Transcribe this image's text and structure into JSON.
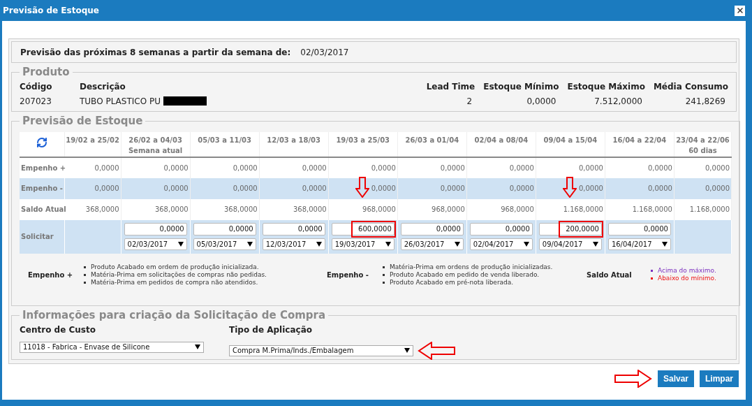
{
  "window": {
    "title": "Previsão de Estoque"
  },
  "forecast_period": {
    "label": "Previsão das próximas 8 semanas a partir da semana de:",
    "date": "02/03/2017"
  },
  "product": {
    "legend": "Produto",
    "identity": [
      {
        "label": "Código",
        "value": "207023",
        "redacted": false
      },
      {
        "label": "Descrição",
        "value": "TUBO PLASTICO PU",
        "redacted": true
      }
    ],
    "metrics": [
      {
        "label": "Lead Time",
        "value": "2"
      },
      {
        "label": "Estoque Mínimo",
        "value": "0,0000"
      },
      {
        "label": "Estoque Máximo",
        "value": "7.512,0000"
      },
      {
        "label": "Média Consumo",
        "value": "241,8269"
      }
    ]
  },
  "forecast": {
    "legend": "Previsão de Estoque",
    "columns": [
      {
        "range": "19/02 a 25/02"
      },
      {
        "range": "26/02 a 04/03",
        "note": "Semana atual"
      },
      {
        "range": "05/03 a 11/03"
      },
      {
        "range": "12/03 a 18/03"
      },
      {
        "range": "19/03 a 25/03"
      },
      {
        "range": "26/03 a 01/04"
      },
      {
        "range": "02/04 a 08/04"
      },
      {
        "range": "09/04 a 15/04"
      },
      {
        "range": "16/04 a 22/04"
      },
      {
        "range": "23/04 a 22/06",
        "note": "60 dias"
      }
    ],
    "rows": [
      {
        "label": "Empenho +",
        "shaded": false,
        "values": [
          "0,0000",
          "0,0000",
          "0,0000",
          "0,0000",
          "0,0000",
          "0,0000",
          "0,0000",
          "0,0000",
          "0,0000",
          "0,0000"
        ]
      },
      {
        "label": "Empenho -",
        "shaded": true,
        "values": [
          "0,0000",
          "0,0000",
          "0,0000",
          "0,0000",
          "0,0000",
          "0,0000",
          "0,0000",
          "0,0000",
          "0,0000",
          "0,0000"
        ]
      },
      {
        "label": "Saldo Atual",
        "shaded": false,
        "values": [
          "368,0000",
          "368,0000",
          "368,0000",
          "368,0000",
          "968,0000",
          "968,0000",
          "968,0000",
          "1.168,0000",
          "1.168,0000",
          "1.168,0000"
        ]
      }
    ],
    "request_row": {
      "label": "Solicitar",
      "cells": [
        {
          "kind": "empty"
        },
        {
          "kind": "entry",
          "quantity": "0,0000",
          "date": "02/03/2017",
          "highlighted": false
        },
        {
          "kind": "entry",
          "quantity": "0,0000",
          "date": "05/03/2017",
          "highlighted": false
        },
        {
          "kind": "entry",
          "quantity": "0,0000",
          "date": "12/03/2017",
          "highlighted": false
        },
        {
          "kind": "entry",
          "quantity": "600,0000",
          "date": "19/03/2017",
          "highlighted": true
        },
        {
          "kind": "entry",
          "quantity": "0,0000",
          "date": "26/03/2017",
          "highlighted": false
        },
        {
          "kind": "entry",
          "quantity": "0,0000",
          "date": "02/04/2017",
          "highlighted": false
        },
        {
          "kind": "entry",
          "quantity": "200,0000",
          "date": "09/04/2017",
          "highlighted": true
        },
        {
          "kind": "entry",
          "quantity": "0,0000",
          "date": "16/04/2017",
          "highlighted": false
        },
        {
          "kind": "empty"
        }
      ]
    },
    "legend_items": [
      {
        "label": "Empenho +",
        "notes": [
          {
            "text": "Produto Acabado em ordem de produção inicializada.",
            "color": "#333333"
          },
          {
            "text": "Matéria-Prima em solicitações de compras não pedidas.",
            "color": "#333333"
          },
          {
            "text": "Matéria-Prima em pedidos de compra não atendidos.",
            "color": "#333333"
          }
        ]
      },
      {
        "label": "Empenho -",
        "notes": [
          {
            "text": "Matéria-Prima em ordens de produção inicializadas.",
            "color": "#333333"
          },
          {
            "text": "Produto Acabado em pedido de venda liberado.",
            "color": "#333333"
          },
          {
            "text": "Produto Acabado em pré-nota liberada.",
            "color": "#333333"
          }
        ]
      },
      {
        "label": "Saldo Atual",
        "notes": [
          {
            "text": "Acima do máximo.",
            "color": "#7b2fbf"
          },
          {
            "text": "Abaixo do mínimo.",
            "color": "#ee1111"
          }
        ]
      }
    ]
  },
  "purchase_request": {
    "legend": "Informações para criação da Solicitação de Compra",
    "fields": [
      {
        "label": "Centro de Custo",
        "value": "11018 - Fabrica - Envase de Silicone",
        "marked": false
      },
      {
        "label": "Tipo de Aplicação",
        "value": "Compra M.Prima/Inds./Embalagem",
        "marked": true
      }
    ]
  },
  "buttons": [
    {
      "label": "Salvar",
      "marked": true
    },
    {
      "label": "Limpar",
      "marked": false
    }
  ]
}
